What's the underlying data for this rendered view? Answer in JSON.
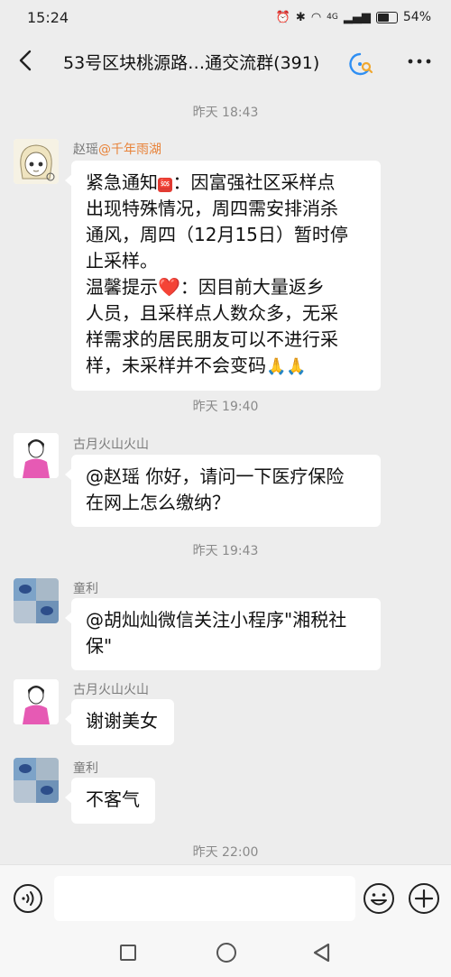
{
  "status": {
    "time": "15:24",
    "network_label": "4G",
    "battery": "54%",
    "battery_level": 0.54
  },
  "header": {
    "title": "53号区块桃源路…通交流群(391)",
    "icons": {
      "back": "back-arrow-icon",
      "group": "group-chat-icon",
      "more": "more-icon"
    }
  },
  "chat": {
    "timestamps": [
      "昨天 18:43",
      "昨天 19:40",
      "昨天 19:43",
      "昨天 22:00"
    ],
    "messages": [
      {
        "sender": "赵瑶",
        "sender_suffix": "@千年雨湖",
        "lines": [
          {
            "pre": "紧急通知",
            "emoji": "🆘",
            "post": "：因富强社区采样点"
          },
          {
            "text": "出现特殊情况，周四需安排消杀"
          },
          {
            "text": "通风，周四（12月15日）暂时停"
          },
          {
            "text": "止采样。"
          },
          {
            "pre": "温馨提示",
            "emoji": "❤️",
            "post": "：因目前大量返乡"
          },
          {
            "text": "人员，且采样点人数众多，无采"
          },
          {
            "text": "样需求的居民朋友可以不进行采"
          },
          {
            "pre": "样，未采样并不会变码",
            "emoji": "🙏🙏"
          }
        ]
      },
      {
        "sender": "古月火山火山",
        "lines": [
          {
            "text": "@赵瑶  你好，请问一下医疗保险"
          },
          {
            "text": "在网上怎么缴纳？"
          }
        ]
      },
      {
        "sender": "童利",
        "lines": [
          {
            "text": "@胡灿灿微信关注小程序\"湘税社"
          },
          {
            "text": "保\""
          }
        ]
      },
      {
        "sender": "古月火山火山",
        "lines": [
          {
            "text": "谢谢美女"
          }
        ]
      },
      {
        "sender": "童利",
        "lines": [
          {
            "text": "不客气"
          }
        ]
      }
    ]
  },
  "input": {
    "placeholder": "",
    "icons": {
      "voice": "voice-icon",
      "emoji": "emoji-icon",
      "plus": "plus-icon"
    }
  },
  "navbar": {
    "icons": [
      "recent-apps-icon",
      "home-icon",
      "back-icon"
    ]
  }
}
